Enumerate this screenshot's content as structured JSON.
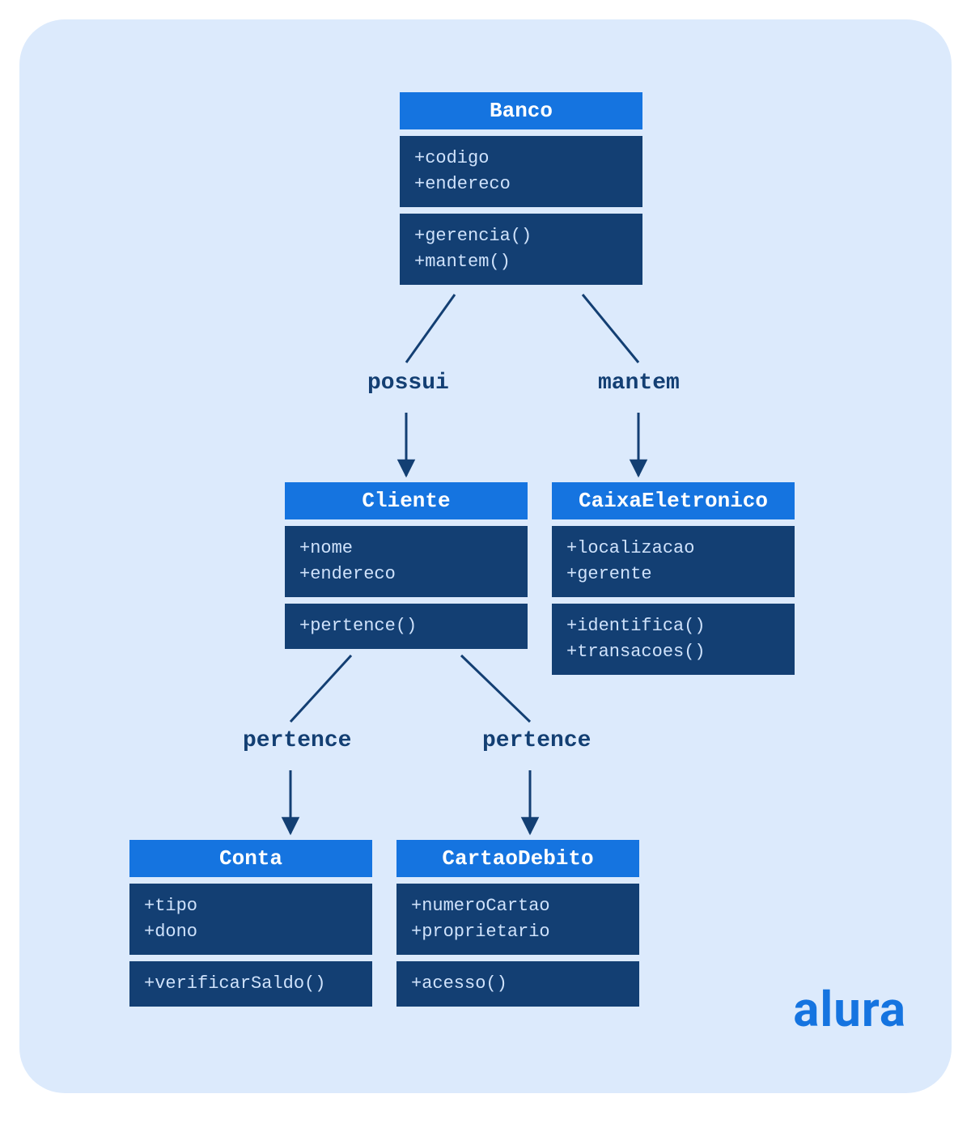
{
  "brand": "alura",
  "relations": {
    "possui": "possui",
    "mantem": "mantem",
    "pertence1": "pertence",
    "pertence2": "pertence"
  },
  "classes": {
    "banco": {
      "name": "Banco",
      "attrs": [
        "+codigo",
        "+endereco"
      ],
      "ops": [
        "+gerencia()",
        "+mantem()"
      ]
    },
    "cliente": {
      "name": "Cliente",
      "attrs": [
        "+nome",
        "+endereco"
      ],
      "ops": [
        "+pertence()"
      ]
    },
    "caixa": {
      "name": "CaixaEletronico",
      "attrs": [
        "+localizacao",
        "+gerente"
      ],
      "ops": [
        "+identifica()",
        "+transacoes()"
      ]
    },
    "conta": {
      "name": "Conta",
      "attrs": [
        "+tipo",
        "+dono"
      ],
      "ops": [
        "+verificarSaldo()"
      ]
    },
    "cartao": {
      "name": "CartaoDebito",
      "attrs": [
        "+numeroCartao",
        "+proprietario"
      ],
      "ops": [
        "+acesso()"
      ]
    }
  }
}
